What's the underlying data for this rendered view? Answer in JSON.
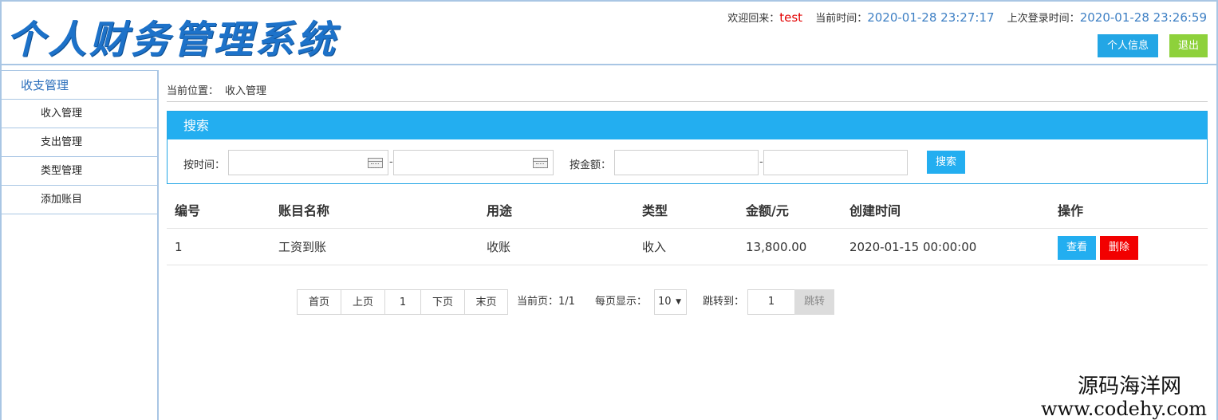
{
  "header": {
    "logo_text": "个人财务管理系统",
    "welcome_label": "欢迎回来：",
    "username": "test",
    "current_time_label": "当前时间：",
    "current_time": "2020-01-28 23:27:17",
    "last_login_label": "上次登录时间：",
    "last_login_time": "2020-01-28 23:26:59",
    "profile_button": "个人信息",
    "logout_button": "退出"
  },
  "sidebar": {
    "group_title": "收支管理",
    "items": [
      {
        "label": "收入管理"
      },
      {
        "label": "支出管理"
      },
      {
        "label": "类型管理"
      },
      {
        "label": "添加账目"
      }
    ]
  },
  "breadcrumb": {
    "label": "当前位置：",
    "current": "收入管理"
  },
  "search": {
    "title": "搜索",
    "time_label": "按时间：",
    "amount_label": "按金额：",
    "separator": "-",
    "button": "搜索",
    "time_from": "",
    "time_to": "",
    "amount_from": "",
    "amount_to": ""
  },
  "table": {
    "columns": [
      "编号",
      "账目名称",
      "用途",
      "类型",
      "金额/元",
      "创建时间",
      "操作"
    ],
    "rows": [
      {
        "id": "1",
        "name": "工资到账",
        "purpose": "收账",
        "type": "收入",
        "amount": "13,800.00",
        "created": "2020-01-15 00:00:00",
        "view_label": "查看",
        "delete_label": "删除"
      }
    ]
  },
  "pagination": {
    "first": "首页",
    "prev": "上页",
    "page": "1",
    "next": "下页",
    "last": "末页",
    "current_page_label": "当前页：",
    "current_page": "1/1",
    "per_page_label": "每页显示：",
    "per_page": "10",
    "jump_label": "跳转到：",
    "jump_value": "1",
    "jump_button": "跳转"
  },
  "watermark": {
    "line1": "源码海洋网",
    "line2": "www.codehy.com"
  },
  "colors": {
    "accent": "#23aef0",
    "logo": "#1d72c9",
    "border": "#a9c6e4",
    "logout": "#8ed13b",
    "danger": "#f20000",
    "username": "#e30000"
  }
}
